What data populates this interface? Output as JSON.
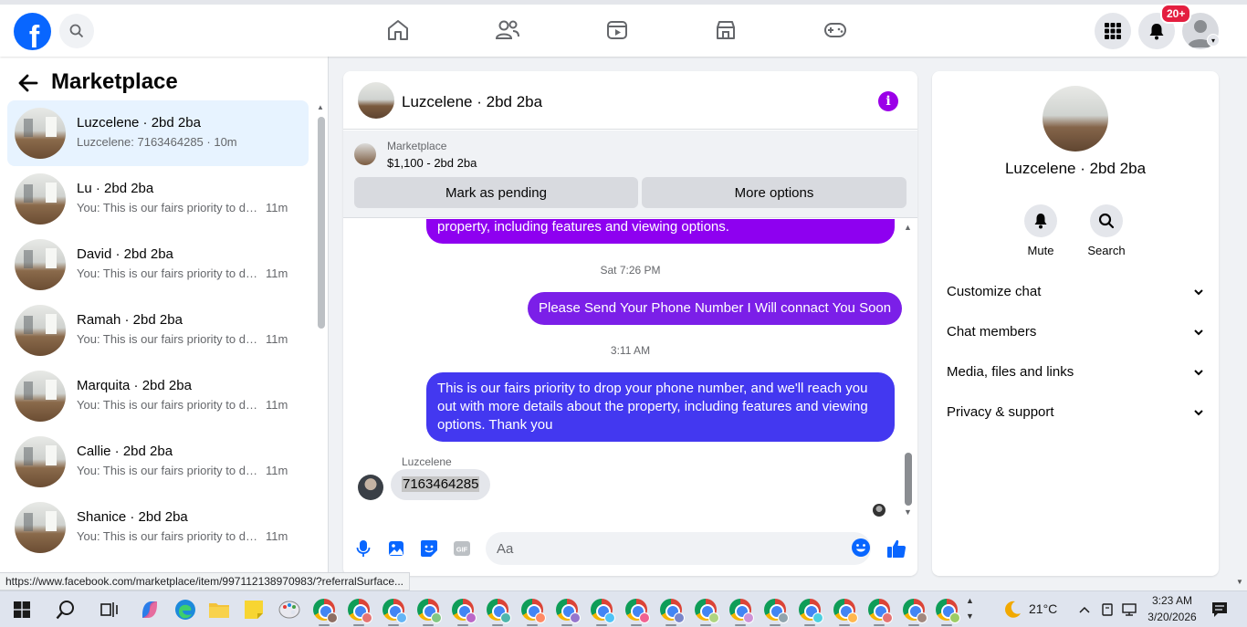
{
  "topbar": {
    "logo": "f",
    "notification_badge": "20+",
    "nav_icons": [
      "home-icon",
      "friends-icon",
      "watch-icon",
      "marketplace-icon",
      "gaming-icon"
    ]
  },
  "left": {
    "title": "Marketplace",
    "conversations": [
      {
        "name": "Luzcelene · 2bd 2ba",
        "snippet": "Luzcelene: 7163464285 · 10m",
        "time": ""
      },
      {
        "name": "Lu · 2bd 2ba",
        "snippet": "You: This is our fairs priority to drop your phone number",
        "time": "11m"
      },
      {
        "name": "David · 2bd 2ba",
        "snippet": "You: This is our fairs priority to drop your phone number",
        "time": "11m"
      },
      {
        "name": "Ramah · 2bd 2ba",
        "snippet": "You: This is our fairs priority to drop your phone number",
        "time": "11m"
      },
      {
        "name": "Marquita · 2bd 2ba",
        "snippet": "You: This is our fairs priority to drop your phone number",
        "time": "11m"
      },
      {
        "name": "Callie · 2bd 2ba",
        "snippet": "You: This is our fairs priority to drop your phone number",
        "time": "11m"
      },
      {
        "name": "Shanice · 2bd 2ba",
        "snippet": "You: This is our fairs priority to drop your phone number",
        "time": "11m"
      }
    ]
  },
  "chat": {
    "title": "Luzcelene · 2bd 2ba",
    "listing": {
      "category": "Marketplace",
      "price_title": "$1,100 - 2bd 2ba",
      "mark_pending": "Mark as pending",
      "more_options": "More options"
    },
    "messages": {
      "partial": "property, including features and viewing options.",
      "ts1": "Sat 7:26 PM",
      "out1": "Please Send Your Phone Number I Will connact You Soon",
      "ts2": "3:11 AM",
      "out2": "This is our fairs priority to drop your phone number, and we'll reach you out with more details about the property, including features and viewing options.  Thank you",
      "sender": "Luzcelene",
      "incoming": "7163464285"
    },
    "composer_placeholder": "Aa",
    "colors": {
      "purple": "#9b00e8",
      "blue_purple": "#5b3cf0",
      "blue": "#3f3df2",
      "accent": "#0866ff"
    }
  },
  "info": {
    "name": "Luzcelene · 2bd 2ba",
    "mute": "Mute",
    "search": "Search",
    "sections": [
      "Customize chat",
      "Chat members",
      "Media, files and links",
      "Privacy & support"
    ]
  },
  "status_url": "https://www.facebook.com/marketplace/item/997112138970983/?referralSurface...",
  "taskbar": {
    "temperature": "21°C",
    "time": "3:23 AM",
    "date": "3/20/2026"
  }
}
